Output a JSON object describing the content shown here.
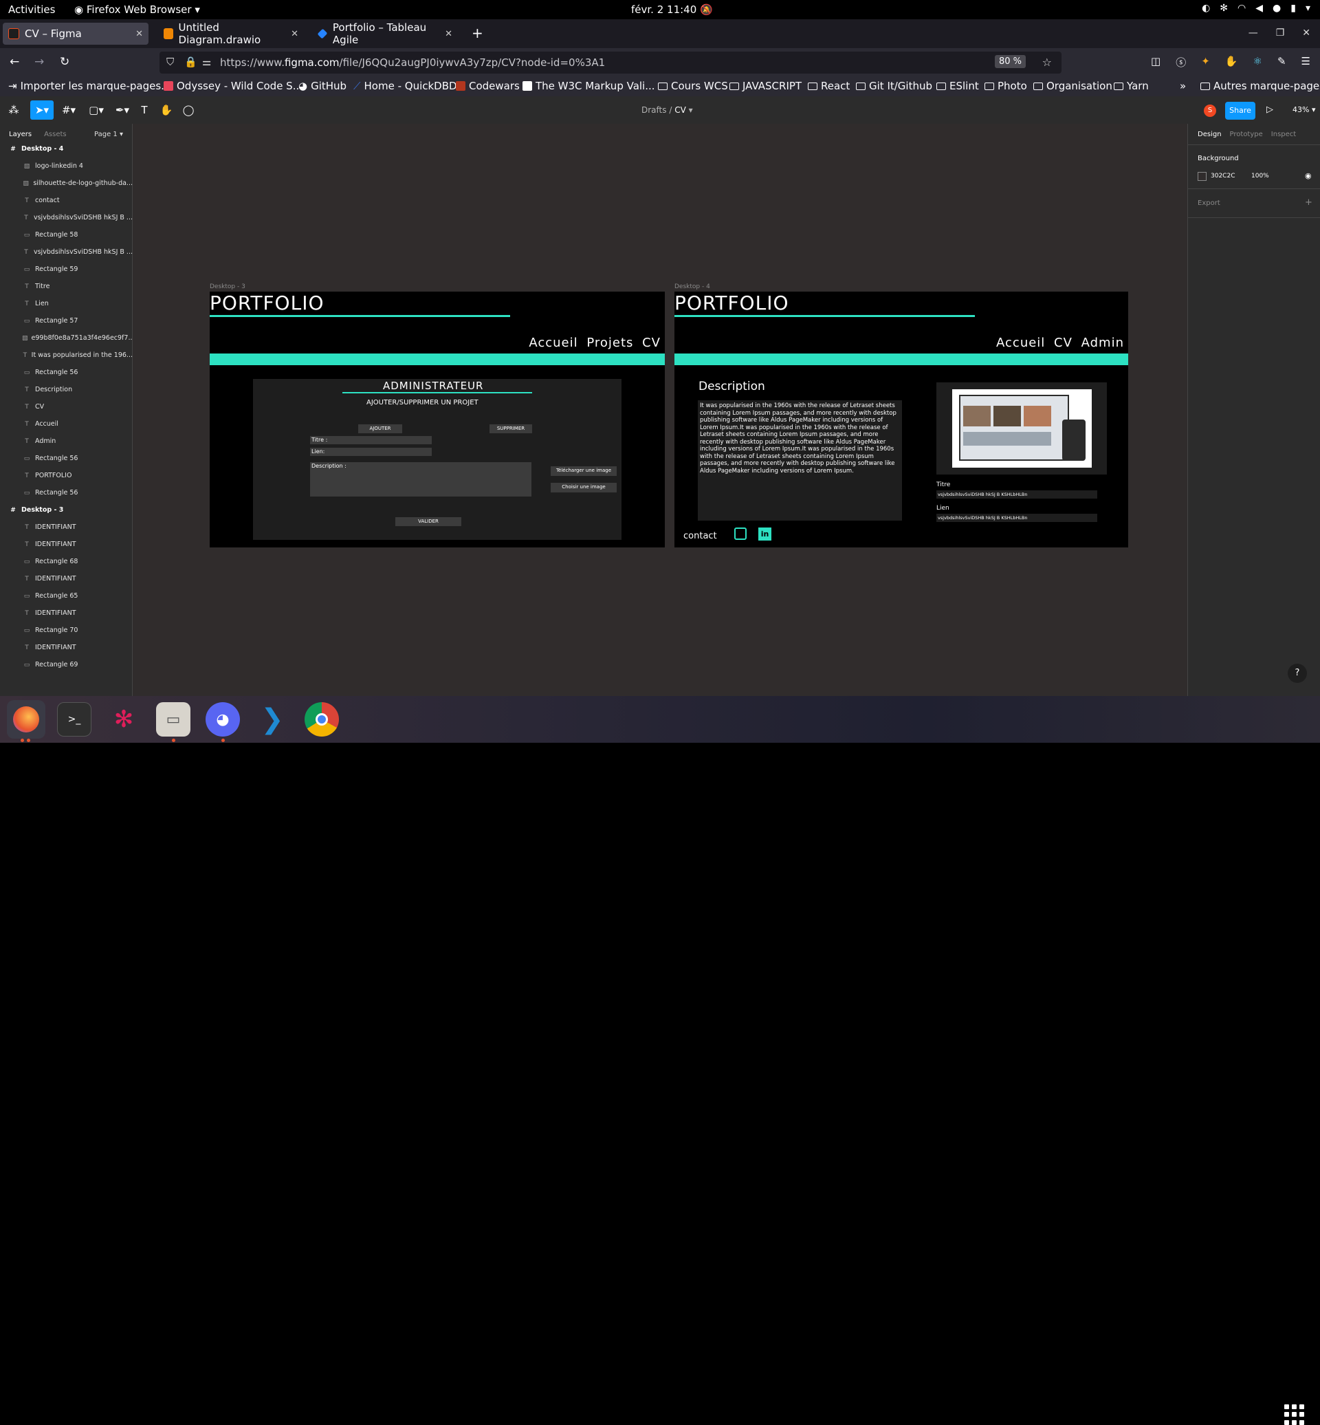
{
  "system_bar": {
    "activities": "Activities",
    "app": "Firefox Web Browser",
    "clock": "févr. 2  11:40"
  },
  "tabs": [
    {
      "title": "CV – Figma",
      "active": true,
      "favicon_color": "#1e1e1e"
    },
    {
      "title": "Untitled Diagram.drawio",
      "active": false,
      "favicon_color": "#f08705"
    },
    {
      "title": "Portfolio – Tableau Agile",
      "active": false,
      "favicon_color": "#2684ff"
    }
  ],
  "navbar": {
    "url_host": "https://www.",
    "url_domain": "figma.com",
    "url_path": "/file/J6QQu2augPJ0iywvA3y7zp/CV?node-id=0%3A1",
    "zoom": "80 %"
  },
  "bookmarks": [
    {
      "label": "Importer les marque-pages...",
      "color": "#ffffff",
      "folder": false
    },
    {
      "label": "Odyssey - Wild Code S...",
      "color": "#e8455a",
      "folder": false
    },
    {
      "label": "GitHub",
      "color": "#ffffff",
      "folder": false
    },
    {
      "label": "Home - QuickDBD",
      "color": "#3b6fd6",
      "folder": false
    },
    {
      "label": "Codewars",
      "color": "#b1361e",
      "folder": false
    },
    {
      "label": "The W3C Markup Vali...",
      "color": "#1a5ea9",
      "folder": false
    },
    {
      "label": "Cours WCS",
      "folder": true
    },
    {
      "label": "JAVASCRIPT",
      "folder": true
    },
    {
      "label": "React",
      "folder": true
    },
    {
      "label": "Git It/Github",
      "folder": true
    },
    {
      "label": "ESlint",
      "folder": true
    },
    {
      "label": "Photo",
      "folder": true
    },
    {
      "label": "Organisation",
      "folder": true
    },
    {
      "label": "Yarn",
      "folder": true
    },
    {
      "label": "Autres marque-pages",
      "folder": true
    }
  ],
  "figma_toolbar": {
    "breadcrumb_parent": "Drafts",
    "breadcrumb_sep": "/",
    "breadcrumb_file": "CV",
    "avatar_initial": "S",
    "share": "Share",
    "zoom": "43%"
  },
  "layers_panel": {
    "tab_layers": "Layers",
    "tab_assets": "Assets",
    "page": "Page 1",
    "rows": [
      {
        "name": "Desktop - 4",
        "icon": "#",
        "frame": true
      },
      {
        "name": "logo-linkedin 4",
        "icon": "▧",
        "frame": false
      },
      {
        "name": "silhouette-de-logo-github-da...",
        "icon": "▧",
        "frame": false
      },
      {
        "name": "contact",
        "icon": "T",
        "frame": false
      },
      {
        "name": "vsjvbdsihlsvSviDSHB hkSJ B ...",
        "icon": "T",
        "frame": false
      },
      {
        "name": "Rectangle 58",
        "icon": "▭",
        "frame": false
      },
      {
        "name": "vsjvbdsihlsvSviDSHB hkSJ B ...",
        "icon": "T",
        "frame": false
      },
      {
        "name": "Rectangle 59",
        "icon": "▭",
        "frame": false
      },
      {
        "name": "Titre",
        "icon": "T",
        "frame": false
      },
      {
        "name": "Lien",
        "icon": "T",
        "frame": false
      },
      {
        "name": "Rectangle 57",
        "icon": "▭",
        "frame": false
      },
      {
        "name": "e99b8f0e8a751a3f4e96ec9f7...",
        "icon": "▧",
        "frame": false
      },
      {
        "name": "It was popularised in the 196...",
        "icon": "T",
        "frame": false
      },
      {
        "name": "Rectangle 56",
        "icon": "▭",
        "frame": false
      },
      {
        "name": "Description",
        "icon": "T",
        "frame": false
      },
      {
        "name": "CV",
        "icon": "T",
        "frame": false
      },
      {
        "name": "Accueil",
        "icon": "T",
        "frame": false
      },
      {
        "name": "Admin",
        "icon": "T",
        "frame": false
      },
      {
        "name": "Rectangle 56",
        "icon": "▭",
        "frame": false
      },
      {
        "name": "PORTFOLIO",
        "icon": "T",
        "frame": false
      },
      {
        "name": "Rectangle 56",
        "icon": "▭",
        "frame": false
      },
      {
        "name": "Desktop - 3",
        "icon": "#",
        "frame": true
      },
      {
        "name": "IDENTIFIANT",
        "icon": "T",
        "frame": false
      },
      {
        "name": "IDENTIFIANT",
        "icon": "T",
        "frame": false
      },
      {
        "name": "Rectangle 68",
        "icon": "▭",
        "frame": false
      },
      {
        "name": "IDENTIFIANT",
        "icon": "T",
        "frame": false
      },
      {
        "name": "Rectangle 65",
        "icon": "▭",
        "frame": false
      },
      {
        "name": "IDENTIFIANT",
        "icon": "T",
        "frame": false
      },
      {
        "name": "Rectangle 70",
        "icon": "▭",
        "frame": false
      },
      {
        "name": "IDENTIFIANT",
        "icon": "T",
        "frame": false
      },
      {
        "name": "Rectangle 69",
        "icon": "▭",
        "frame": false
      }
    ]
  },
  "properties_panel": {
    "tab_design": "Design",
    "tab_prototype": "Prototype",
    "tab_inspect": "Inspect",
    "background_label": "Background",
    "background_hex": "302C2C",
    "background_opacity": "100%",
    "export_label": "Export",
    "background_color": "#302c2c"
  },
  "desktop3": {
    "label": "Desktop - 3",
    "title": "PORTFOLIO",
    "nav": "Accueil  Projets  CV",
    "admin_title": "ADMINISTRATEUR",
    "subtitle": "AJOUTER/SUPPRIMER UN PROJET",
    "btn_add": "AJOUTER",
    "btn_delete": "SUPPRIMER",
    "field_title": "Titre :",
    "field_link": "Lien:",
    "field_description": "Description :",
    "btn_download": "Télécharger une image",
    "btn_choose": "Choisir une image",
    "btn_validate": "VALIDER"
  },
  "desktop4": {
    "label": "Desktop - 4",
    "title": "PORTFOLIO",
    "nav": "Accueil  CV  Admin",
    "desc_title": "Description",
    "desc_text": "It was popularised in the 1960s with the release of Letraset sheets containing Lorem Ipsum passages, and more recently with desktop publishing software like Aldus PageMaker including versions of Lorem Ipsum.It was popularised in the 1960s with the release of Letraset sheets containing Lorem Ipsum passages, and more recently with desktop publishing software like Aldus PageMaker including versions of Lorem Ipsum.It was popularised in the 1960s with the release of Letraset sheets containing Lorem Ipsum passages, and more recently with desktop publishing software like Aldus PageMaker including versions of Lorem Ipsum.",
    "titre_label": "Titre",
    "titre_value": "vsjvbdsihlsvSviDSHB hkSJ B KSHLbHLBn",
    "lien_label": "Lien",
    "lien_value": "vsjvbdsihlsvSviDSHB hkSJ B KSHLbHLBn",
    "contact": "contact"
  },
  "accent_color": "#2de1c2",
  "dock": [
    {
      "name": "firefox",
      "color": "#e8542e",
      "running": true
    },
    {
      "name": "terminal",
      "color": "#2e2e2e",
      "running": false
    },
    {
      "name": "slack",
      "color": "#ffffff",
      "running": false
    },
    {
      "name": "files",
      "color": "#d8d4cc",
      "running": true
    },
    {
      "name": "discord",
      "color": "#5865f2",
      "running": true
    },
    {
      "name": "vscode",
      "color": "#1f8ad2",
      "running": false
    },
    {
      "name": "chrome",
      "color": "#e9b52b",
      "running": false
    }
  ]
}
